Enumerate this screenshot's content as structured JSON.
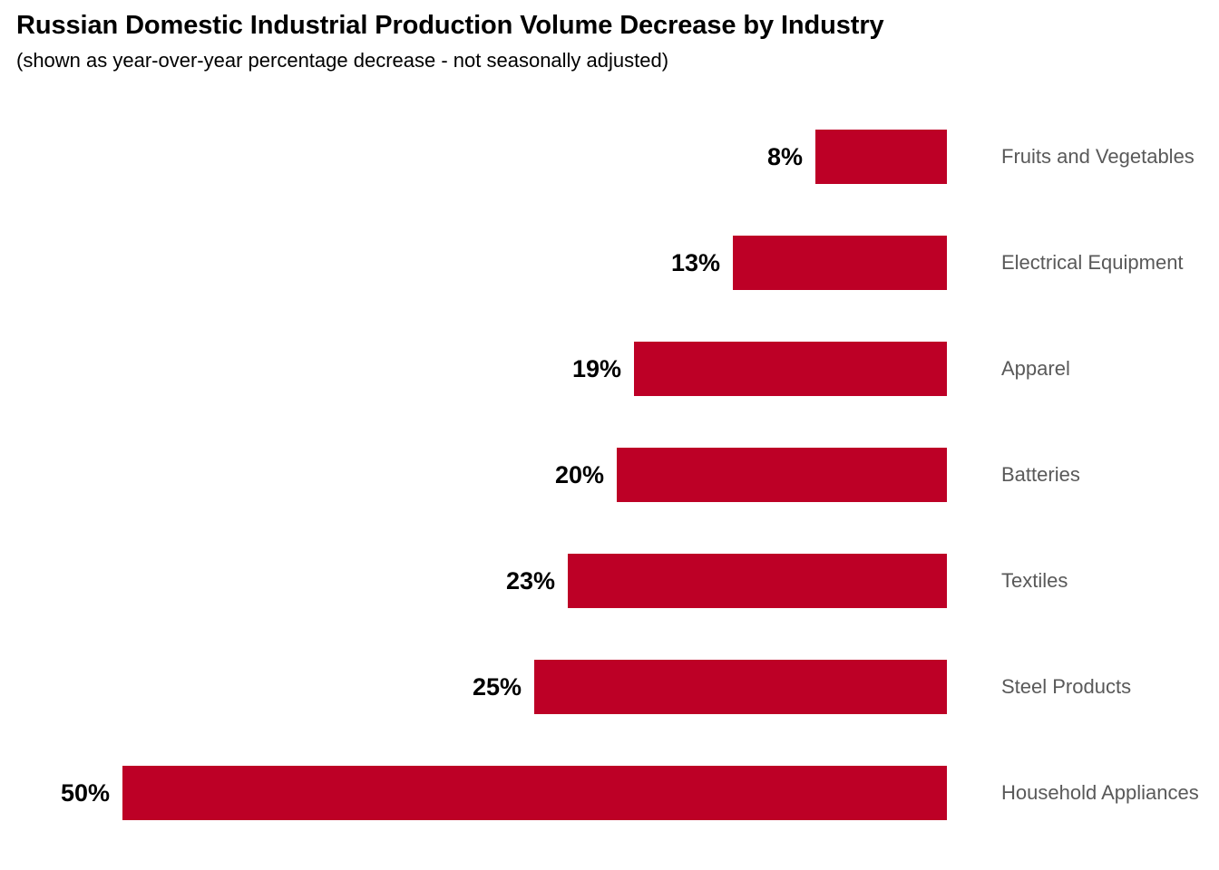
{
  "header": {
    "title": "Russian Domestic Industrial Production Volume Decrease by Industry",
    "subtitle": "(shown as year-over-year percentage decrease - not seasonally adjusted)"
  },
  "colors": {
    "bar": "#bd0026",
    "value_label": "#000000",
    "category_label": "#595959",
    "background": "#ffffff"
  },
  "chart_data": {
    "type": "bar",
    "orientation": "horizontal",
    "direction": "right-to-left",
    "title": "Russian Domestic Industrial Production Volume Decrease by Industry",
    "subtitle": "(shown as year-over-year percentage decrease - not seasonally adjusted)",
    "xlabel": "",
    "ylabel": "",
    "xlim": [
      0,
      50
    ],
    "grid": false,
    "legend": false,
    "unit": "%",
    "categories": [
      "Fruits and Vegetables",
      "Electrical Equipment",
      "Apparel",
      "Batteries",
      "Textiles",
      "Steel Products",
      "Household Appliances"
    ],
    "values": [
      8,
      13,
      19,
      20,
      23,
      25,
      50
    ],
    "value_labels": [
      "8%",
      "13%",
      "19%",
      "20%",
      "23%",
      "25%",
      "50%"
    ],
    "series": [
      {
        "name": "Year-over-year percentage decrease",
        "values": [
          8,
          13,
          19,
          20,
          23,
          25,
          50
        ]
      }
    ],
    "bars": [
      {
        "label": "Fruits and Vegetables",
        "value": 8,
        "value_label": "8%"
      },
      {
        "label": "Electrical Equipment",
        "value": 13,
        "value_label": "13%"
      },
      {
        "label": "Apparel",
        "value": 19,
        "value_label": "19%"
      },
      {
        "label": "Batteries",
        "value": 20,
        "value_label": "20%"
      },
      {
        "label": "Textiles",
        "value": 23,
        "value_label": "23%"
      },
      {
        "label": "Steel Products",
        "value": 25,
        "value_label": "25%"
      },
      {
        "label": "Household Appliances",
        "value": 50,
        "value_label": "50%"
      }
    ]
  }
}
